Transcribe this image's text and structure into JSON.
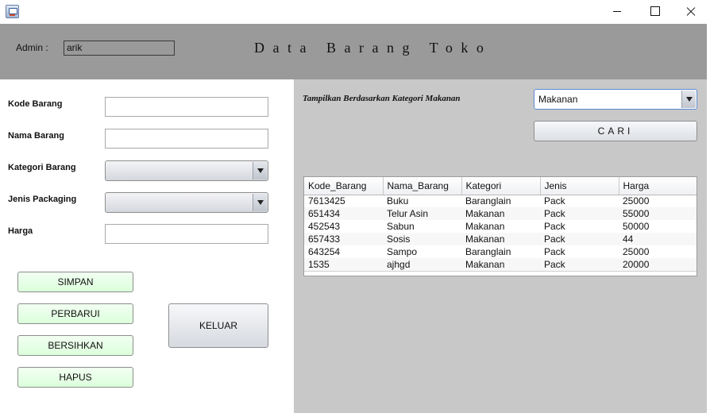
{
  "header": {
    "admin_label": "Admin :",
    "admin_value": "arik",
    "title": "Data Barang Toko"
  },
  "form": {
    "kode_label": "Kode Barang",
    "nama_label": "Nama Barang",
    "kategori_label": "Kategori Barang",
    "jenis_label": "Jenis Packaging",
    "harga_label": "Harga",
    "kode_value": "",
    "nama_value": "",
    "kategori_value": "",
    "jenis_value": "",
    "harga_value": ""
  },
  "buttons": {
    "simpan": "SIMPAN",
    "perbarui": "PERBARUI",
    "bersihkan": "BERSIHKAN",
    "hapus": "HAPUS",
    "keluar": "KELUAR"
  },
  "filter": {
    "label": "Tampilkan Berdasarkan Kategori Makanan",
    "selected": "Makanan",
    "search_button": "CARI"
  },
  "table": {
    "columns": [
      "Kode_Barang",
      "Nama_Barang",
      "Kategori",
      "Jenis",
      "Harga"
    ],
    "rows": [
      [
        "7613425",
        "Buku",
        "Baranglain",
        "Pack",
        "25000"
      ],
      [
        "651434",
        "Telur Asin",
        "Makanan",
        "Pack",
        "55000"
      ],
      [
        "452543",
        "Sabun",
        "Makanan",
        "Pack",
        "50000"
      ],
      [
        "657433",
        "Sosis",
        "Makanan",
        "Pack",
        "44"
      ],
      [
        "643254",
        "Sampo",
        "Baranglain",
        "Pack",
        "25000"
      ],
      [
        "1535",
        "ajhgd",
        "Makanan",
        "Pack",
        "20000"
      ]
    ]
  },
  "colors": {
    "header_bg": "#9a9a9a",
    "right_panel_bg": "#c8c8c8",
    "action_button_bg": "#dcffdc"
  },
  "icons": {
    "app": "java-app-icon",
    "minimize": "minimize-icon",
    "maximize": "maximize-icon",
    "close": "close-icon",
    "dropdown": "chevron-down-icon"
  }
}
